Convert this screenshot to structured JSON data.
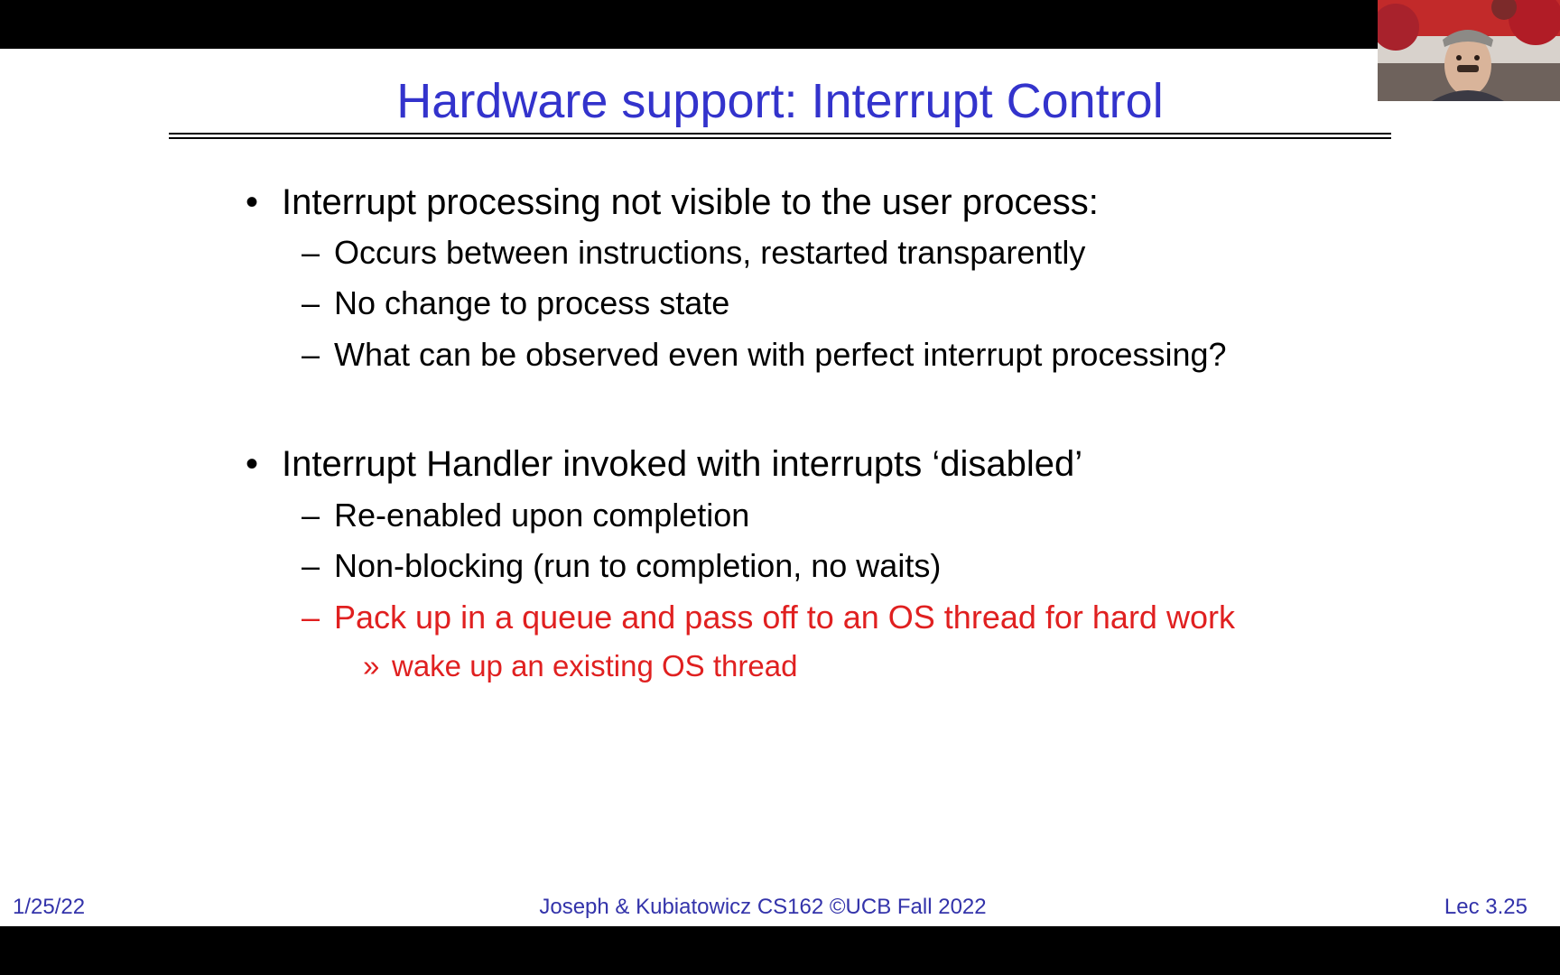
{
  "slide": {
    "title": "Hardware support: Interrupt Control",
    "bullets": [
      {
        "marker": "•",
        "text": "Interrupt processing not visible to the user process:",
        "sub": [
          {
            "marker": "–",
            "text": "Occurs between instructions, restarted transparently"
          },
          {
            "marker": "–",
            "text": "No change to process state"
          },
          {
            "marker": "–",
            "text": "What can be observed even with perfect interrupt processing?"
          }
        ]
      },
      {
        "marker": "•",
        "text": "Interrupt Handler invoked with interrupts ‘disabled’",
        "sub": [
          {
            "marker": "–",
            "text": "Re-enabled upon completion"
          },
          {
            "marker": "–",
            "text": "Non-blocking (run to completion, no waits)"
          },
          {
            "marker": "–",
            "text": "Pack up in a queue and pass off to an OS thread for hard work",
            "color": "#e02020"
          }
        ],
        "subsub": [
          {
            "marker": "»",
            "text": "wake up an existing OS thread",
            "color": "#e02020"
          }
        ]
      }
    ],
    "footer": {
      "date": "1/25/22",
      "center": "Joseph & Kubiatowicz CS162 ©UCB Fall 2022",
      "slide_number": "Lec 3.25"
    },
    "colors": {
      "title": "#3333cc",
      "footer": "#3333aa",
      "highlight": "#e02020"
    }
  },
  "webcam": {
    "icon": "presenter-video-icon"
  }
}
